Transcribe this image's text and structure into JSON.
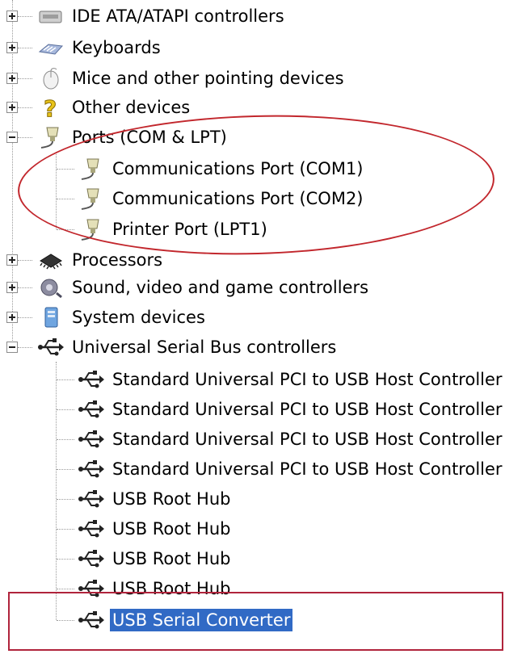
{
  "device_tree": {
    "categories": [
      {
        "label": "IDE ATA/ATAPI controllers",
        "icon": "ide-controller-icon",
        "expander": "plus"
      },
      {
        "label": "Keyboards",
        "icon": "keyboard-icon",
        "expander": "plus"
      },
      {
        "label": "Mice and other pointing devices",
        "icon": "mouse-icon",
        "expander": "plus"
      },
      {
        "label": "Other devices",
        "icon": "question-mark-icon",
        "expander": "plus"
      },
      {
        "label": "Ports (COM & LPT)",
        "icon": "port-connector-icon",
        "expander": "minus",
        "children": [
          {
            "label": "Communications Port (COM1)",
            "icon": "port-connector-icon"
          },
          {
            "label": "Communications Port (COM2)",
            "icon": "port-connector-icon"
          },
          {
            "label": "Printer Port (LPT1)",
            "icon": "port-connector-icon"
          }
        ]
      },
      {
        "label": "Processors",
        "icon": "processor-icon",
        "expander": "plus"
      },
      {
        "label": "Sound, video and game controllers",
        "icon": "sound-icon",
        "expander": "plus"
      },
      {
        "label": "System devices",
        "icon": "system-devices-icon",
        "expander": "plus"
      },
      {
        "label": "Universal Serial Bus controllers",
        "icon": "usb-icon",
        "expander": "minus",
        "children": [
          {
            "label": "Standard Universal PCI to USB Host Controller",
            "icon": "usb-icon"
          },
          {
            "label": "Standard Universal PCI to USB Host Controller",
            "icon": "usb-icon"
          },
          {
            "label": "Standard Universal PCI to USB Host Controller",
            "icon": "usb-icon"
          },
          {
            "label": "Standard Universal PCI to USB Host Controller",
            "icon": "usb-icon"
          },
          {
            "label": "USB Root Hub",
            "icon": "usb-icon"
          },
          {
            "label": "USB Root Hub",
            "icon": "usb-icon"
          },
          {
            "label": "USB Root Hub",
            "icon": "usb-icon"
          },
          {
            "label": "USB Root Hub",
            "icon": "usb-icon"
          },
          {
            "label": "USB Serial Converter",
            "icon": "usb-icon",
            "selected": true
          }
        ]
      }
    ]
  },
  "colors": {
    "selection_bg": "#316ac5",
    "selection_text": "#ffffff",
    "annotation_red": "#c2272d"
  }
}
